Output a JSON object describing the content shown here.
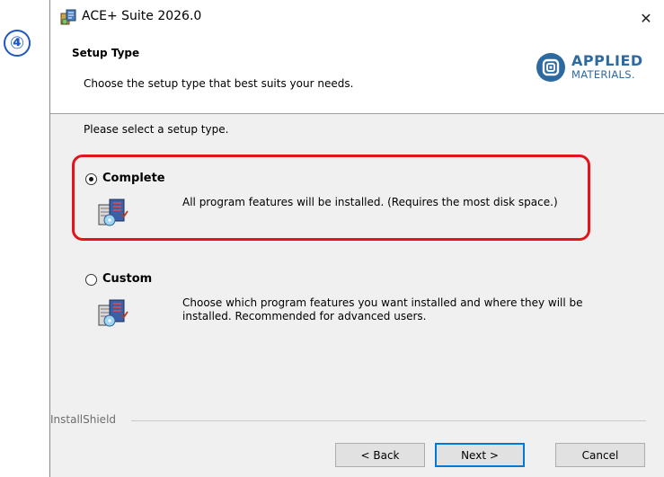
{
  "step_badge": "④",
  "window": {
    "title": "ACE+ Suite 2026.0",
    "close_glyph": "✕"
  },
  "banner": {
    "title": "Setup Type",
    "subtitle": "Choose the setup type that best suits your needs.",
    "logo_line1": "APPLIED",
    "logo_line2": "MATERIALS."
  },
  "prompt": "Please select a setup type.",
  "options": [
    {
      "label": "Complete",
      "selected": true,
      "description": "All program features will be installed. (Requires the most disk space.)",
      "icon": "installer-box-icon"
    },
    {
      "label": "Custom",
      "selected": false,
      "description": "Choose which program features you want installed and where they will be installed. Recommended for advanced users.",
      "icon": "installer-box-icon"
    }
  ],
  "footer": {
    "brand": "InstallShield"
  },
  "buttons": {
    "back": "< Back",
    "next": "Next >",
    "cancel": "Cancel"
  },
  "colors": {
    "highlight": "#e3141b",
    "badge": "#1f57c3",
    "logo": "#2c6aa0",
    "default_button_border": "#0078d7"
  }
}
